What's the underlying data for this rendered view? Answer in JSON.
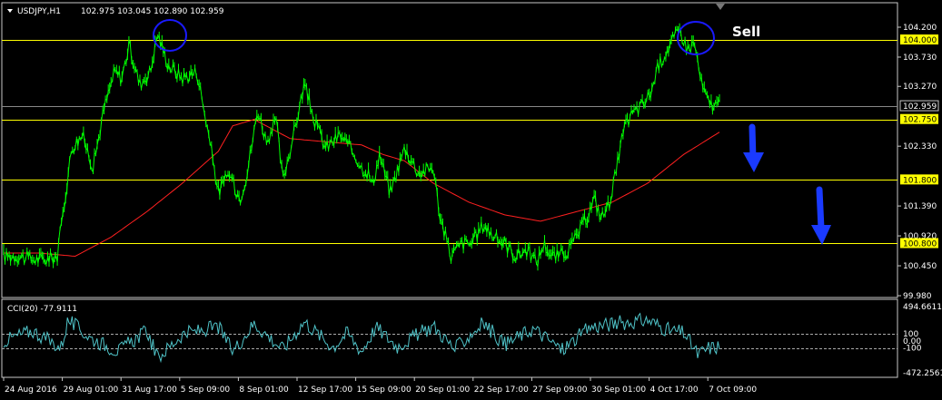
{
  "window": {
    "symbol": "USDJPY,H1",
    "ohlc": "102.975 103.045 102.890 102.959"
  },
  "annotations": {
    "sell_label": "Sell"
  },
  "colors": {
    "background": "#000000",
    "price": "#00ff00",
    "moving_average": "#ff2020",
    "level_line": "#ffff00",
    "cci": "#4fc3c8",
    "circle": "#1a1aff",
    "arrow": "#1a3aff",
    "axis_text": "#ffffff",
    "grid": "#c8c8c8"
  },
  "chart_data": [
    {
      "type": "line",
      "panel": "price",
      "x_tick_labels": [
        "24 Aug 2016",
        "29 Aug 01:00",
        "31 Aug 17:00",
        "5 Sep 09:00",
        "8 Sep 01:00",
        "12 Sep 17:00",
        "15 Sep 09:00",
        "20 Sep 01:00",
        "22 Sep 17:00",
        "27 Sep 09:00",
        "30 Sep 01:00",
        "4 Oct 17:00",
        "7 Oct 09:00"
      ],
      "y_tick_labels": [
        "104.200",
        "103.730",
        "103.270",
        "102.330",
        "101.390",
        "100.920",
        "100.450",
        "99.980"
      ],
      "ylim": [
        99.98,
        104.2
      ],
      "levels": [
        {
          "label": "104.000",
          "value": 104.0
        },
        {
          "label": "102.750",
          "value": 102.75
        },
        {
          "label": "101.800",
          "value": 101.8
        },
        {
          "label": "100.800",
          "value": 100.8
        }
      ],
      "current_price": {
        "label": "102.959",
        "value": 102.959
      },
      "series": [
        {
          "kind": "price",
          "x": [
            0,
            0.02,
            0.04,
            0.06,
            0.075,
            0.095,
            0.11,
            0.125,
            0.14,
            0.155,
            0.165,
            0.175,
            0.19,
            0.205,
            0.215,
            0.23,
            0.25,
            0.27,
            0.285,
            0.3,
            0.315,
            0.33,
            0.34,
            0.355,
            0.37,
            0.38,
            0.39,
            0.405,
            0.42,
            0.435,
            0.45,
            0.47,
            0.49,
            0.5,
            0.51,
            0.515,
            0.525,
            0.54,
            0.56,
            0.58,
            0.6,
            0.61,
            0.625,
            0.64,
            0.655,
            0.67,
            0.685,
            0.7,
            0.715,
            0.73,
            0.745,
            0.755,
            0.765,
            0.775,
            0.79,
            0.805,
            0.815,
            0.825,
            0.835,
            0.845,
            0.855,
            0.865,
            0.875,
            0.885,
            0.895,
            0.905,
            0.915,
            0.925,
            0.935,
            0.945,
            0.955,
            0.965,
            0.975,
            0.985,
            1.0
          ],
          "y": [
            100.6,
            100.6,
            100.55,
            100.55,
            100.6,
            102.3,
            102.5,
            102.0,
            102.9,
            103.5,
            103.4,
            103.9,
            103.3,
            103.5,
            104.1,
            103.6,
            103.4,
            103.5,
            102.6,
            101.6,
            101.9,
            101.5,
            101.9,
            102.9,
            102.3,
            102.8,
            101.8,
            102.5,
            103.3,
            102.7,
            102.3,
            102.5,
            102.2,
            102.0,
            101.9,
            101.7,
            102.2,
            101.6,
            102.3,
            101.9,
            102.0,
            101.2,
            100.6,
            100.8,
            100.8,
            101.1,
            100.9,
            100.8,
            100.6,
            100.7,
            100.5,
            100.8,
            100.6,
            100.6,
            100.7,
            101.0,
            101.2,
            101.5,
            101.2,
            101.4,
            101.9,
            102.5,
            102.8,
            102.9,
            103.0,
            103.2,
            103.6,
            103.8,
            104.0,
            104.15,
            103.85,
            103.95,
            103.3,
            103.0,
            102.96
          ]
        },
        {
          "kind": "moving_average",
          "x": [
            0,
            0.05,
            0.1,
            0.15,
            0.2,
            0.25,
            0.3,
            0.32,
            0.35,
            0.4,
            0.45,
            0.5,
            0.53,
            0.56,
            0.6,
            0.65,
            0.7,
            0.75,
            0.8,
            0.85,
            0.9,
            0.95,
            1.0
          ],
          "y": [
            100.65,
            100.65,
            100.6,
            100.9,
            101.3,
            101.75,
            102.25,
            102.65,
            102.75,
            102.45,
            102.4,
            102.35,
            102.2,
            102.1,
            101.75,
            101.45,
            101.25,
            101.15,
            101.3,
            101.45,
            101.75,
            102.2,
            102.55
          ]
        }
      ]
    },
    {
      "type": "line",
      "panel": "cci",
      "title": "CCI(20) -77.9111",
      "y_tick_labels": [
        "494.6611",
        "100",
        "0.00",
        "-100",
        "-472.2561"
      ],
      "ylim": [
        -472.2561,
        494.6611
      ],
      "reference_levels": [
        100,
        -100
      ],
      "series": [
        {
          "kind": "cci",
          "x": [
            0,
            0.04,
            0.08,
            0.09,
            0.12,
            0.16,
            0.2,
            0.215,
            0.25,
            0.3,
            0.32,
            0.35,
            0.39,
            0.42,
            0.46,
            0.48,
            0.5,
            0.52,
            0.55,
            0.6,
            0.63,
            0.67,
            0.7,
            0.74,
            0.78,
            0.82,
            0.86,
            0.9,
            0.93,
            0.95,
            0.97,
            0.985,
            1.0
          ],
          "y": [
            0,
            150,
            -100,
            300,
            50,
            -150,
            150,
            -250,
            100,
            200,
            -150,
            250,
            -120,
            280,
            -90,
            120,
            -150,
            200,
            -80,
            220,
            -120,
            260,
            -50,
            180,
            -130,
            200,
            260,
            300,
            150,
            120,
            -200,
            -100,
            -78
          ]
        }
      ]
    }
  ]
}
